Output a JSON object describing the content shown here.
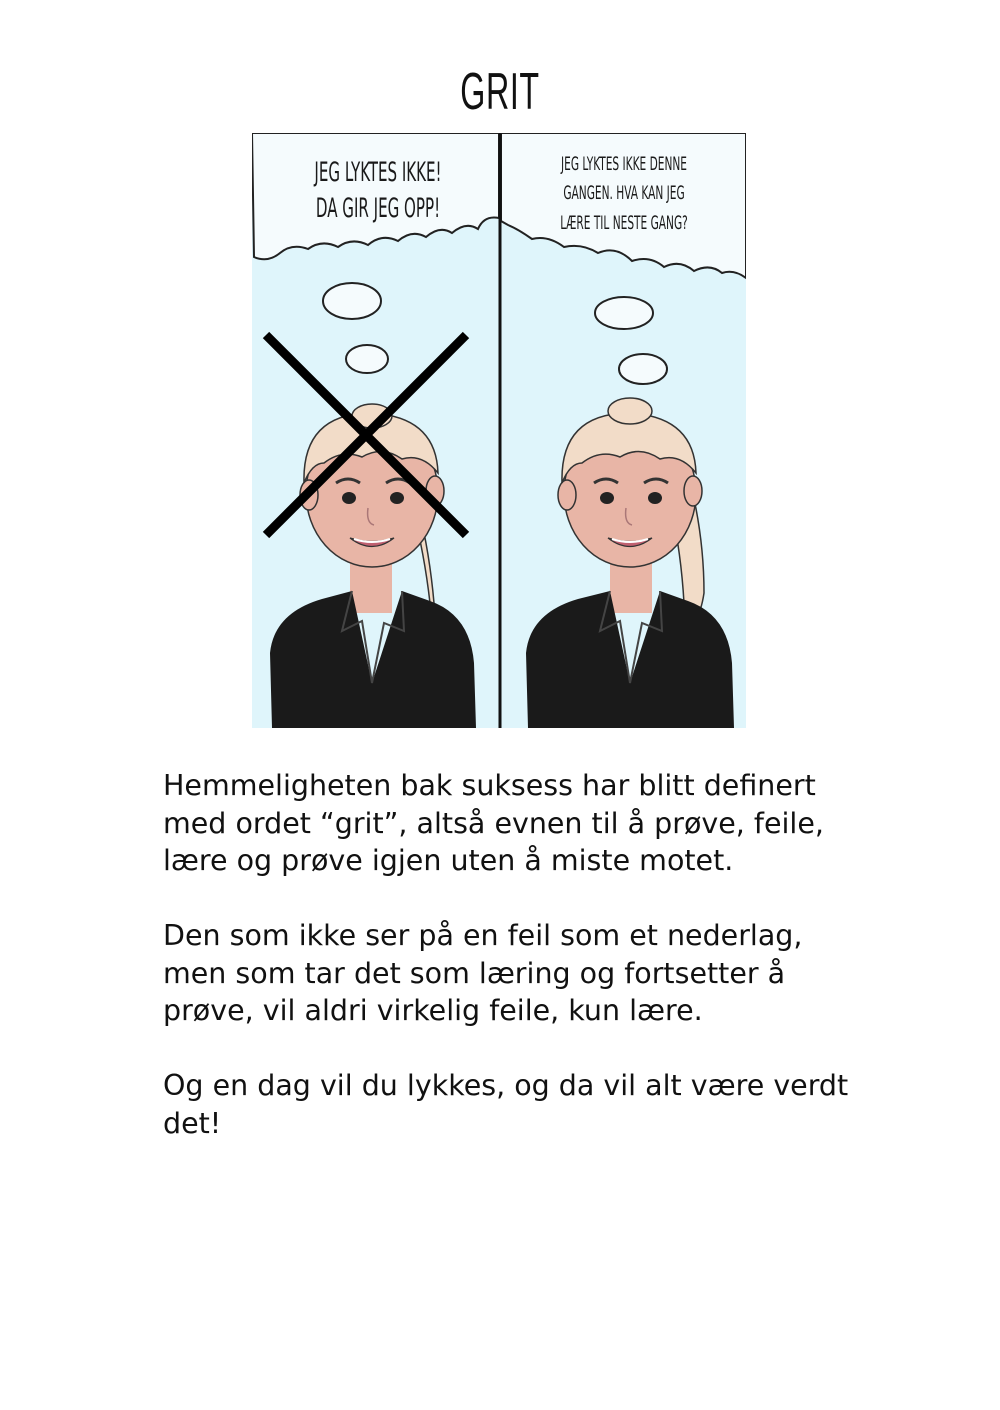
{
  "title": "GRIT",
  "illustration": {
    "left_thought": "Jeg lyktes ikke! Da gir jeg opp!",
    "right_thought": "Jeg lyktes ikke denne gangen. Hva kan jeg lære til neste gang?",
    "colors": {
      "sky": "#dff5fb",
      "cloud": "#f5fbfd",
      "skin": "#e8b5a6",
      "hair": "#f2dcc8",
      "shirt": "#1a1a1a",
      "cross": "#000000"
    }
  },
  "paragraphs": [
    "Hemmeligheten bak suksess har blitt definert med ordet “grit”, altså evnen til å prøve, feile, lære og prøve igjen uten å miste motet.",
    "Den som ikke ser på en feil som et nederlag, men som tar det som læring og fortsetter å prøve, vil aldri virkelig feile, kun lære.",
    "Og en dag vil du lykkes, og da vil alt være verdt det!"
  ]
}
